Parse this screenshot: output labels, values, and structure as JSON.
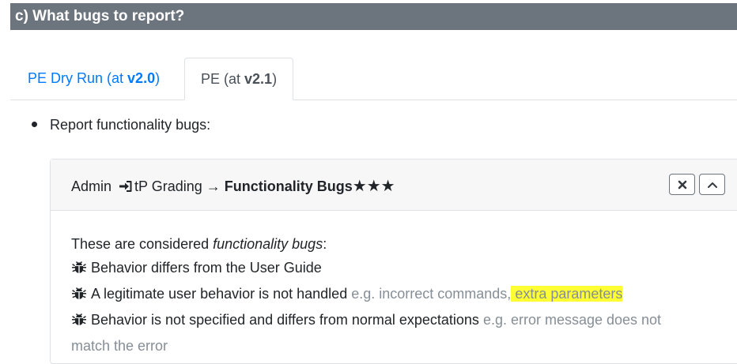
{
  "header": {
    "title": "c) What bugs to report?"
  },
  "tabs": [
    {
      "label": "PE Dry Run (at ",
      "version": "v2.0",
      "close": ")"
    },
    {
      "label": "PE (at ",
      "version": "v2.1",
      "close": ")"
    }
  ],
  "bullet": {
    "text": "Report functionality bugs:"
  },
  "card": {
    "crumb_admin": "Admin",
    "crumb_grading": "tP Grading →",
    "crumb_title": "Functionality Bugs",
    "stars": "★★★",
    "intro_prefix": "These are considered ",
    "intro_emph": "functionality bugs",
    "intro_suffix": ":",
    "item1": "Behavior differs from the User Guide",
    "item2_main": "A legitimate user behavior is not handled",
    "item2_gray": "e.g. incorrect commands,",
    "item2_highlight": "extra parameters",
    "item3_main": "Behavior is not specified and differs from normal expectations",
    "item3_gray_a": "e.g. error message does not",
    "item3_gray_b": "match the error"
  },
  "icons": [
    "sign-in-icon",
    "bug-icon",
    "close-icon",
    "chevron-up-icon"
  ],
  "colors": {
    "header_bg": "#6c757d",
    "link": "#007bff",
    "highlight": "#ffff33",
    "muted": "#868e96"
  }
}
